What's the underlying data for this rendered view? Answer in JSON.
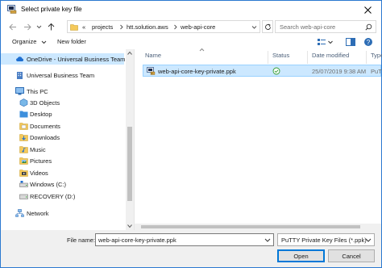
{
  "window": {
    "title": "Select private key file"
  },
  "address": {
    "overflow": "«",
    "crumbs": [
      "projects",
      "htt.solution.aws",
      "web-api-core"
    ]
  },
  "search": {
    "placeholder": "Search web-api-core"
  },
  "toolbar": {
    "organize": "Organize",
    "new_folder": "New folder"
  },
  "sidebar": {
    "items": [
      {
        "label": "OneDrive - Universal Business Team",
        "icon": "cloud-icon",
        "selected": true
      },
      {
        "label": "Universal Business Team",
        "icon": "building-icon"
      },
      {
        "label": "This PC",
        "icon": "computer-icon"
      },
      {
        "label": "3D Objects",
        "icon": "3d-objects-icon"
      },
      {
        "label": "Desktop",
        "icon": "desktop-folder-icon"
      },
      {
        "label": "Documents",
        "icon": "documents-folder-icon"
      },
      {
        "label": "Downloads",
        "icon": "downloads-folder-icon"
      },
      {
        "label": "Music",
        "icon": "music-folder-icon"
      },
      {
        "label": "Pictures",
        "icon": "pictures-folder-icon"
      },
      {
        "label": "Videos",
        "icon": "videos-folder-icon"
      },
      {
        "label": "Windows (C:)",
        "icon": "drive-icon"
      },
      {
        "label": "RECOVERY (D:)",
        "icon": "drive-icon"
      },
      {
        "label": "Network",
        "icon": "network-icon"
      }
    ]
  },
  "columns": {
    "name": "Name",
    "status": "Status",
    "date": "Date modified",
    "type": "Type"
  },
  "files": [
    {
      "name": "web-api-core-key-private.ppk",
      "status": "synced-check-icon",
      "date": "25/07/2019 9:38 AM",
      "type": "PuTTY"
    }
  ],
  "footer": {
    "file_name_label": "File name:",
    "file_name_value": "web-api-core-key-private.ppk",
    "file_type": "PuTTY Private Key Files (*.ppk)",
    "open": "Open",
    "cancel": "Cancel"
  },
  "colors": {
    "accent": "#0078d7",
    "selection": "#cce8ff",
    "folder": "#f0c040"
  }
}
